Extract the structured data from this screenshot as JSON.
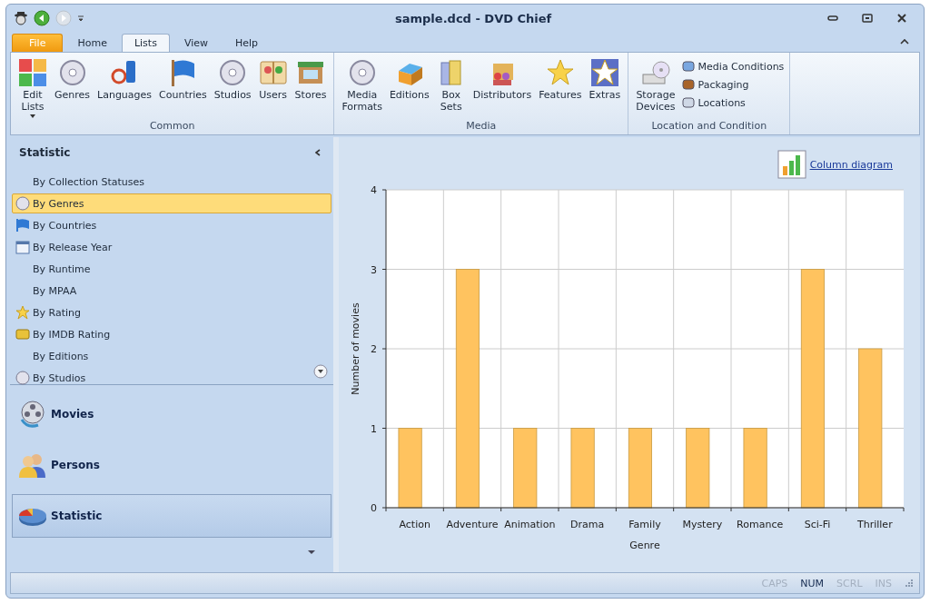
{
  "window": {
    "title": "sample.dcd - DVD Chief"
  },
  "tabs": [
    {
      "label": "File",
      "selected": false,
      "kind": "file"
    },
    {
      "label": "Home",
      "selected": false,
      "kind": "tab"
    },
    {
      "label": "Lists",
      "selected": true,
      "kind": "tab"
    },
    {
      "label": "View",
      "selected": false,
      "kind": "tab"
    },
    {
      "label": "Help",
      "selected": false,
      "kind": "tab"
    }
  ],
  "ribbon": {
    "groups": [
      {
        "label": "Common",
        "items": [
          {
            "label": "Edit\nLists",
            "dropdown": true
          },
          {
            "label": "Genres"
          },
          {
            "label": "Languages"
          },
          {
            "label": "Countries"
          },
          {
            "label": "Studios"
          },
          {
            "label": "Users"
          },
          {
            "label": "Stores"
          }
        ]
      },
      {
        "label": "Media",
        "items": [
          {
            "label": "Media\nFormats"
          },
          {
            "label": "Editions"
          },
          {
            "label": "Box\nSets"
          },
          {
            "label": "Distributors"
          },
          {
            "label": "Features"
          },
          {
            "label": "Extras"
          }
        ]
      },
      {
        "label": "Location and Condition",
        "items": [
          {
            "label": "Storage\nDevices"
          }
        ],
        "small_items": [
          "Media Conditions",
          "Packaging",
          "Locations"
        ]
      }
    ]
  },
  "sidebar": {
    "title": "Statistic",
    "items": [
      {
        "label": "By Collection Statuses",
        "selected": false
      },
      {
        "label": "By Genres",
        "selected": true
      },
      {
        "label": "By Countries",
        "selected": false
      },
      {
        "label": "By Release Year",
        "selected": false
      },
      {
        "label": "By Runtime",
        "selected": false
      },
      {
        "label": "By MPAA",
        "selected": false
      },
      {
        "label": "By Rating",
        "selected": false
      },
      {
        "label": "By IMDB Rating",
        "selected": false
      },
      {
        "label": "By Editions",
        "selected": false
      },
      {
        "label": "By Studios",
        "selected": false
      }
    ],
    "sections": [
      {
        "label": "Movies",
        "selected": false
      },
      {
        "label": "Persons",
        "selected": false
      },
      {
        "label": "Statistic",
        "selected": true
      }
    ]
  },
  "content": {
    "link": "Column diagram",
    "chart_data": {
      "type": "bar",
      "xlabel": "Genre",
      "ylabel": "Number of movies",
      "categories": [
        "Action",
        "Adventure",
        "Animation",
        "Drama",
        "Family",
        "Mystery",
        "Romance",
        "Sci-Fi",
        "Thriller"
      ],
      "series": [
        {
          "color": "#ffc35f",
          "values": [
            1,
            3,
            1,
            1,
            1,
            1,
            1,
            3,
            2
          ]
        }
      ],
      "grid": true,
      "ylim": [
        0,
        4
      ],
      "yticks": [
        0,
        1,
        2,
        3,
        4
      ]
    }
  },
  "status_bar": [
    {
      "label": "CAPS",
      "on": false
    },
    {
      "label": "NUM",
      "on": true
    },
    {
      "label": "SCRL",
      "on": false
    },
    {
      "label": "INS",
      "on": false
    }
  ]
}
